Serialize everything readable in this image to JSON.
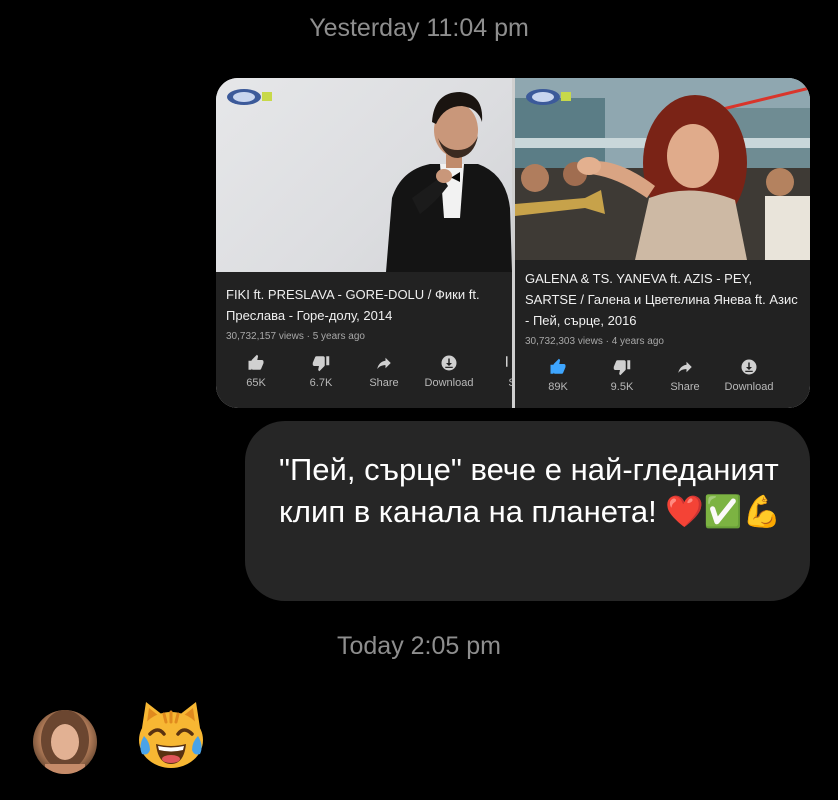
{
  "timestamps": {
    "first": "Yesterday 11:04 pm",
    "second": "Today 2:05 pm"
  },
  "shared_image": {
    "videos": [
      {
        "title": "FIKI ft. PRESLAVA - GORE-DOLU / Фики ft. Преслава - Горе-долу, 2014",
        "meta": "30,732,157 views · 5 years ago",
        "actions": {
          "like": "65K",
          "dislike": "6.7K",
          "share": "Share",
          "download": "Download",
          "save": "S"
        }
      },
      {
        "title": "GALENA & TS. YANEVA ft. AZIS - PEY, SARTSE / Галена и Цветелина Янева ft. Азис - Пей, сърце, 2016",
        "meta": "30,732,303 views · 4 years ago",
        "actions": {
          "like": "89K",
          "dislike": "9.5K",
          "share": "Share",
          "download": "Download"
        }
      }
    ],
    "colors": {
      "info_background": "#222222",
      "like_active": "#3ea6ff",
      "icon_default": "#d0d0d0"
    }
  },
  "message": {
    "text": "\"Пей, сърце\" вече е най-гледаният клип в канала на планета! ❤️✅💪"
  },
  "reply": {
    "emoji": "😹"
  },
  "colors": {
    "background": "#000000",
    "bubble": "#262626",
    "timestamp": "#8e8e8e"
  }
}
